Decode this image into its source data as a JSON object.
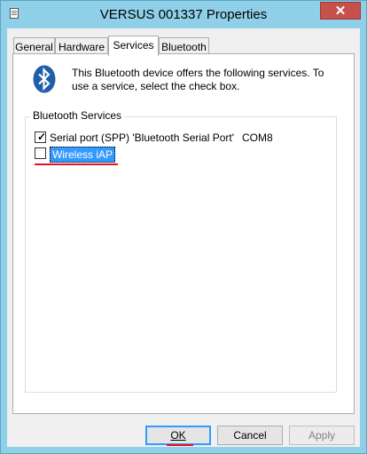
{
  "window": {
    "title": "VERSUS 001337 Properties",
    "close_glyph": "✕"
  },
  "tabs": [
    {
      "label": "General"
    },
    {
      "label": "Hardware"
    },
    {
      "label": "Services",
      "active": true
    },
    {
      "label": "Bluetooth"
    }
  ],
  "services_page": {
    "description": "This Bluetooth device offers the following services. To use a service, select the check box.",
    "group_title": "Bluetooth Services",
    "services": [
      {
        "name": "Serial port (SPP) 'Bluetooth Serial Port'",
        "port": "COM8",
        "checked": true
      },
      {
        "name": "Wireless iAP",
        "port": "",
        "checked": false
      }
    ]
  },
  "buttons": {
    "ok": "OK",
    "cancel": "Cancel",
    "apply": "Apply"
  },
  "colors": {
    "frame": "#8fd0e8",
    "close": "#c7504b",
    "bluetooth": "#1f5fa8",
    "highlight_mark": "#e81123",
    "selection": "#3399ff"
  }
}
